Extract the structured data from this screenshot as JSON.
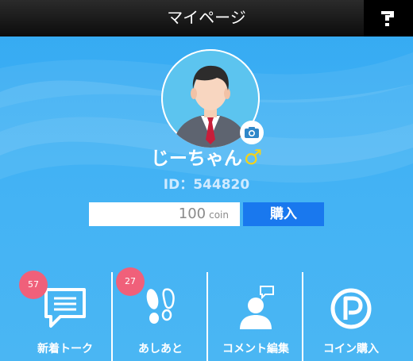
{
  "header": {
    "title": "マイページ",
    "help_icon": "help-question-icon"
  },
  "profile": {
    "name": "じーちゃん",
    "gender_symbol": "♂",
    "id_label": "ID：544820",
    "avatar_icon": "male-businessman-avatar",
    "camera_icon": "camera-icon"
  },
  "coins": {
    "value": "100",
    "unit": "coin",
    "buy_label": "購入"
  },
  "menu": [
    {
      "label": "新着トーク",
      "badge": "57",
      "icon": "chat-bubble-icon"
    },
    {
      "label": "あしあと",
      "badge": "27",
      "icon": "footprints-icon"
    },
    {
      "label": "コメント編集",
      "badge": "",
      "icon": "person-comment-icon"
    },
    {
      "label": "コイン購入",
      "badge": "",
      "icon": "coin-p-icon"
    }
  ],
  "colors": {
    "header_bg": "#0c0c0c",
    "background": "#42b2f4",
    "buy_button": "#1978ee",
    "badge": "#f0607a",
    "gender": "#f2d21c"
  }
}
